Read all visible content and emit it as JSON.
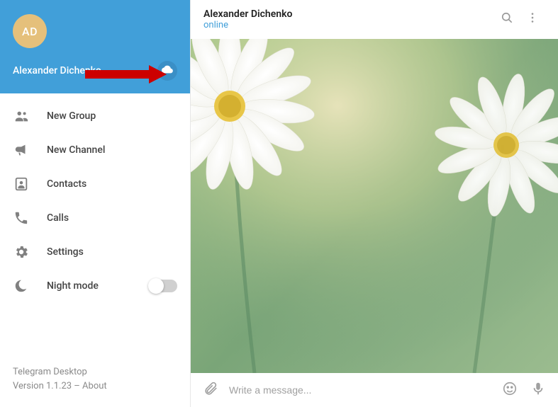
{
  "sidebar": {
    "avatar_initials": "AD",
    "user_name": "Alexander Dichenko",
    "menu": [
      {
        "label": "New Group"
      },
      {
        "label": "New Channel"
      },
      {
        "label": "Contacts"
      },
      {
        "label": "Calls"
      },
      {
        "label": "Settings"
      },
      {
        "label": "Night mode"
      }
    ],
    "footer_app": "Telegram Desktop",
    "footer_version": "Version 1.1.23 – About"
  },
  "chat": {
    "title": "Alexander Dichenko",
    "status": "online"
  },
  "composer": {
    "placeholder": "Write a message..."
  }
}
